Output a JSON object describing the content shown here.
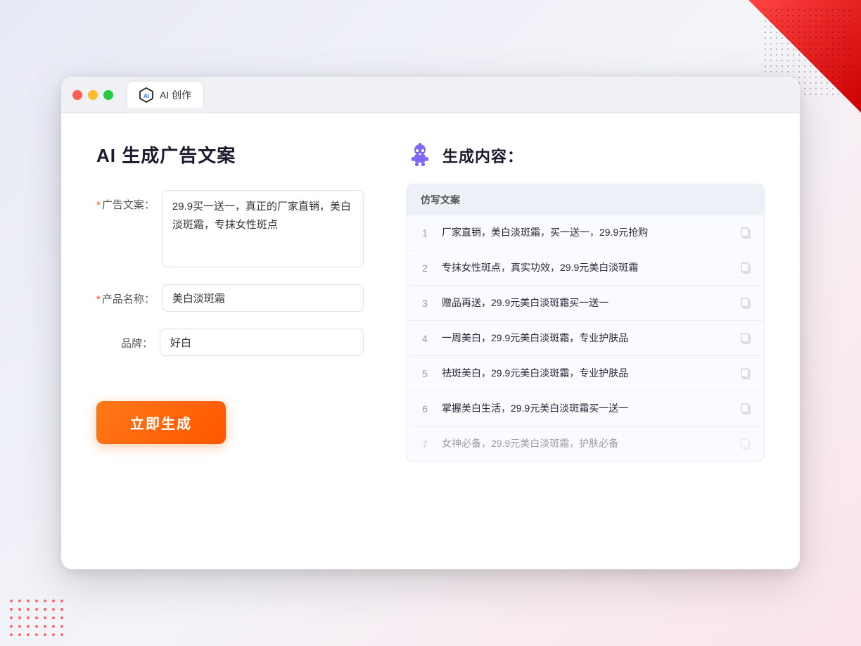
{
  "window": {
    "tab_title": "AI 创作"
  },
  "left": {
    "page_title": "AI 生成广告文案",
    "fields": [
      {
        "label": "广告文案：",
        "required": true,
        "type": "textarea",
        "value": "29.9买一送一，真正的厂家直销，美白淡斑霜，专抹女性斑点",
        "name": "ad-copy-input"
      },
      {
        "label": "产品名称：",
        "required": true,
        "type": "input",
        "value": "美白淡斑霜",
        "name": "product-name-input"
      },
      {
        "label": "品牌：",
        "required": false,
        "type": "input",
        "value": "好白",
        "name": "brand-input"
      }
    ],
    "button_label": "立即生成"
  },
  "right": {
    "title": "生成内容：",
    "table_header": "仿写文案",
    "results": [
      {
        "num": "1",
        "text": "厂家直销，美白淡斑霜，买一送一，29.9元抢购",
        "dimmed": false
      },
      {
        "num": "2",
        "text": "专抹女性斑点，真实功效，29.9元美白淡斑霜",
        "dimmed": false
      },
      {
        "num": "3",
        "text": "赠品再送，29.9元美白淡斑霜买一送一",
        "dimmed": false
      },
      {
        "num": "4",
        "text": "一周美白，29.9元美白淡斑霜，专业护肤品",
        "dimmed": false
      },
      {
        "num": "5",
        "text": "祛斑美白，29.9元美白淡斑霜，专业护肤品",
        "dimmed": false
      },
      {
        "num": "6",
        "text": "掌握美白生活，29.9元美白淡斑霜买一送一",
        "dimmed": false
      },
      {
        "num": "7",
        "text": "女神必备，29.9元美白淡斑霜，护肤必备",
        "dimmed": true
      }
    ]
  },
  "colors": {
    "accent_orange": "#ff5500",
    "accent_blue": "#6b8cff",
    "robot_purple": "#6c5ce7"
  }
}
